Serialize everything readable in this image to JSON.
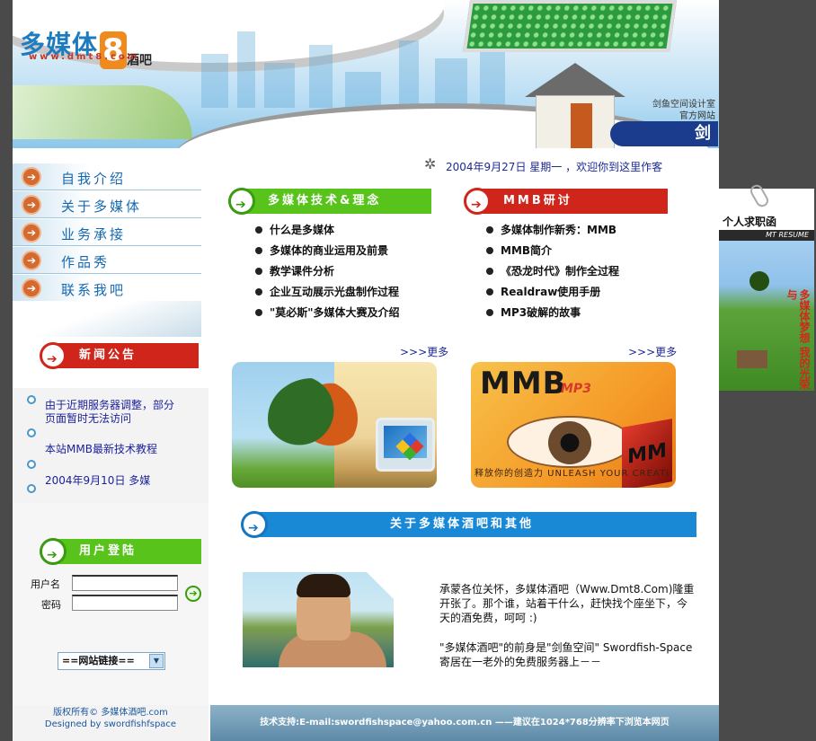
{
  "header": {
    "logo_cn": "多媒体",
    "logo_8": "8",
    "logo_bar": "酒吧",
    "logo_url": "www.dmt8.com",
    "studio_line1": "剑鱼空间设计室",
    "studio_line2": "官方网站",
    "sword_badge": "剑"
  },
  "nav": {
    "items": [
      {
        "label": "自我介绍"
      },
      {
        "label": "关于多媒体"
      },
      {
        "label": "业务承接"
      },
      {
        "label": "作品秀"
      },
      {
        "label": "联系我吧"
      }
    ]
  },
  "news": {
    "title": "新闻公告",
    "items": [
      {
        "text": "由于近期服务器调整，部分页面暂时无法访问"
      },
      {
        "text": "本站MMB最新技术教程"
      },
      {
        "text": "2004年9月10日  多媒"
      }
    ]
  },
  "login": {
    "title": "用户登陆",
    "username_label": "用户名",
    "password_label": "密码",
    "username_value": "",
    "password_value": "",
    "links_select": "==网站链接=="
  },
  "left_footer": {
    "line1": "版权所有© 多媒体酒吧.com",
    "line2": "Designed by swordfishfspace"
  },
  "main": {
    "welcome": "2004年9月27日  星期一 ，欢迎你到这里作客",
    "sections": [
      {
        "title": "多媒体技术&理念",
        "items": [
          "什么是多媒体",
          "多媒体的商业运用及前景",
          "教学课件分析",
          "企业互动展示光盘制作过程",
          "\"莫必斯\"多媒体大赛及介绍"
        ],
        "more": ">>>更多"
      },
      {
        "title": "MMB研讨",
        "items": [
          "多媒体制作新秀：MMB",
          "MMB简介",
          "《恐龙时代》制作全过程",
          "Realdraw使用手册",
          "MP3破解的故事"
        ],
        "more": ">>>更多"
      }
    ],
    "mmb_card": {
      "title": "MMB",
      "mp3": "MP3",
      "slogan": "释放你的创造力  UNLEASH YOUR CREATI"
    },
    "about": {
      "title": "关于多媒体酒吧和其他",
      "p1": "承蒙各位关怀，多媒体酒吧（Www.Dmt8.Com)隆重开张了。那个谁，站着干什么，赶快找个座坐下，今天的酒免费，呵呵 :)",
      "p2": "\"多媒体酒吧\"的前身是\"剑鱼空间\" Swordfish-Space寄居在一老外的免费服务器上－－"
    },
    "footer": "技术支持:E-mail:swordfishspace@yahoo.com.cn ——建议在1024*768分辨率下浏览本网页"
  },
  "ad": {
    "title": "个人求职函",
    "subtitle": "MT RESUME",
    "vertical": "多媒体梦想 我的光荣与"
  },
  "colors": {
    "red_bar": "#d0251b",
    "green_bar": "#58c31b",
    "blue_bar": "#1989d6",
    "nav_text": "#1468b0"
  }
}
